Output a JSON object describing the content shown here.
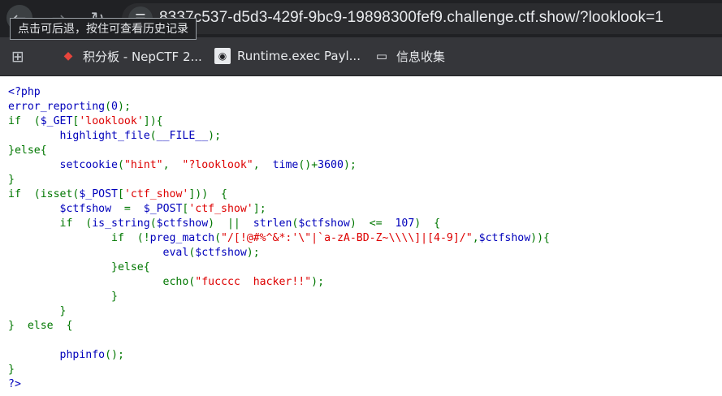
{
  "browser": {
    "url": "8337c537-d5d3-429f-9bc9-19898300fef9.challenge.ctf.show/?looklook=1",
    "tooltip": "点击可后退，按住可查看历史记录",
    "bookmarks": [
      {
        "label": "积分板 - NepCTF 2...",
        "icon": "nep-logo-icon"
      },
      {
        "label": "Runtime.exec Payl...",
        "icon": "runtime-favicon-icon"
      },
      {
        "label": "信息收集",
        "icon": "folder-icon"
      }
    ]
  },
  "code_lines": [
    [
      {
        "c": "b",
        "t": "<?php"
      }
    ],
    [
      {
        "c": "b",
        "t": "error_reporting"
      },
      {
        "c": "g",
        "t": "("
      },
      {
        "c": "b",
        "t": "0"
      },
      {
        "c": "g",
        "t": ");"
      }
    ],
    [
      {
        "c": "g",
        "t": "if  ("
      },
      {
        "c": "b",
        "t": "$_GET"
      },
      {
        "c": "g",
        "t": "["
      },
      {
        "c": "r",
        "t": "'looklook'"
      },
      {
        "c": "g",
        "t": "]){"
      }
    ],
    [
      {
        "c": "b",
        "t": "        highlight_file"
      },
      {
        "c": "g",
        "t": "("
      },
      {
        "c": "b",
        "t": "__FILE__"
      },
      {
        "c": "g",
        "t": ");"
      }
    ],
    [
      {
        "c": "g",
        "t": "}else{"
      }
    ],
    [
      {
        "c": "b",
        "t": "        setcookie"
      },
      {
        "c": "g",
        "t": "("
      },
      {
        "c": "r",
        "t": "\"hint\""
      },
      {
        "c": "g",
        "t": ",  "
      },
      {
        "c": "r",
        "t": "\"?looklook\""
      },
      {
        "c": "g",
        "t": ",  "
      },
      {
        "c": "b",
        "t": "time"
      },
      {
        "c": "g",
        "t": "()+"
      },
      {
        "c": "b",
        "t": "3600"
      },
      {
        "c": "g",
        "t": ");"
      }
    ],
    [
      {
        "c": "g",
        "t": "}"
      }
    ],
    [
      {
        "c": "g",
        "t": "if  (isset("
      },
      {
        "c": "b",
        "t": "$_POST"
      },
      {
        "c": "g",
        "t": "["
      },
      {
        "c": "r",
        "t": "'ctf_show'"
      },
      {
        "c": "g",
        "t": "]))  {"
      }
    ],
    [
      {
        "c": "b",
        "t": "        $ctfshow  "
      },
      {
        "c": "g",
        "t": "=  "
      },
      {
        "c": "b",
        "t": "$_POST"
      },
      {
        "c": "g",
        "t": "["
      },
      {
        "c": "r",
        "t": "'ctf_show'"
      },
      {
        "c": "g",
        "t": "];"
      }
    ],
    [
      {
        "c": "g",
        "t": "        if  ("
      },
      {
        "c": "b",
        "t": "is_string"
      },
      {
        "c": "g",
        "t": "("
      },
      {
        "c": "b",
        "t": "$ctfshow"
      },
      {
        "c": "g",
        "t": ")  ||  "
      },
      {
        "c": "b",
        "t": "strlen"
      },
      {
        "c": "g",
        "t": "("
      },
      {
        "c": "b",
        "t": "$ctfshow"
      },
      {
        "c": "g",
        "t": ")  <=  "
      },
      {
        "c": "b",
        "t": "107"
      },
      {
        "c": "g",
        "t": ")  {"
      }
    ],
    [
      {
        "c": "g",
        "t": "                if  (!"
      },
      {
        "c": "b",
        "t": "preg_match"
      },
      {
        "c": "g",
        "t": "("
      },
      {
        "c": "r",
        "t": "\"/[!@#%^&*:'\\\"|`a-zA-BD-Z~\\\\\\\\]|[4-9]/\""
      },
      {
        "c": "g",
        "t": ","
      },
      {
        "c": "b",
        "t": "$ctfshow"
      },
      {
        "c": "g",
        "t": ")){"
      }
    ],
    [
      {
        "c": "b",
        "t": "                        eval"
      },
      {
        "c": "g",
        "t": "("
      },
      {
        "c": "b",
        "t": "$ctfshow"
      },
      {
        "c": "g",
        "t": ");"
      }
    ],
    [
      {
        "c": "g",
        "t": "                }else{"
      }
    ],
    [
      {
        "c": "g",
        "t": "                        echo("
      },
      {
        "c": "r",
        "t": "\"fucccc  hacker!!\""
      },
      {
        "c": "g",
        "t": ");"
      }
    ],
    [
      {
        "c": "g",
        "t": "                }"
      }
    ],
    [
      {
        "c": "g",
        "t": "        }"
      }
    ],
    [
      {
        "c": "g",
        "t": "}  else  {"
      }
    ],
    [
      {
        "c": "g",
        "t": ""
      }
    ],
    [
      {
        "c": "b",
        "t": "        phpinfo"
      },
      {
        "c": "g",
        "t": "();"
      }
    ],
    [
      {
        "c": "g",
        "t": "}"
      }
    ],
    [
      {
        "c": "b",
        "t": "?>"
      }
    ]
  ]
}
